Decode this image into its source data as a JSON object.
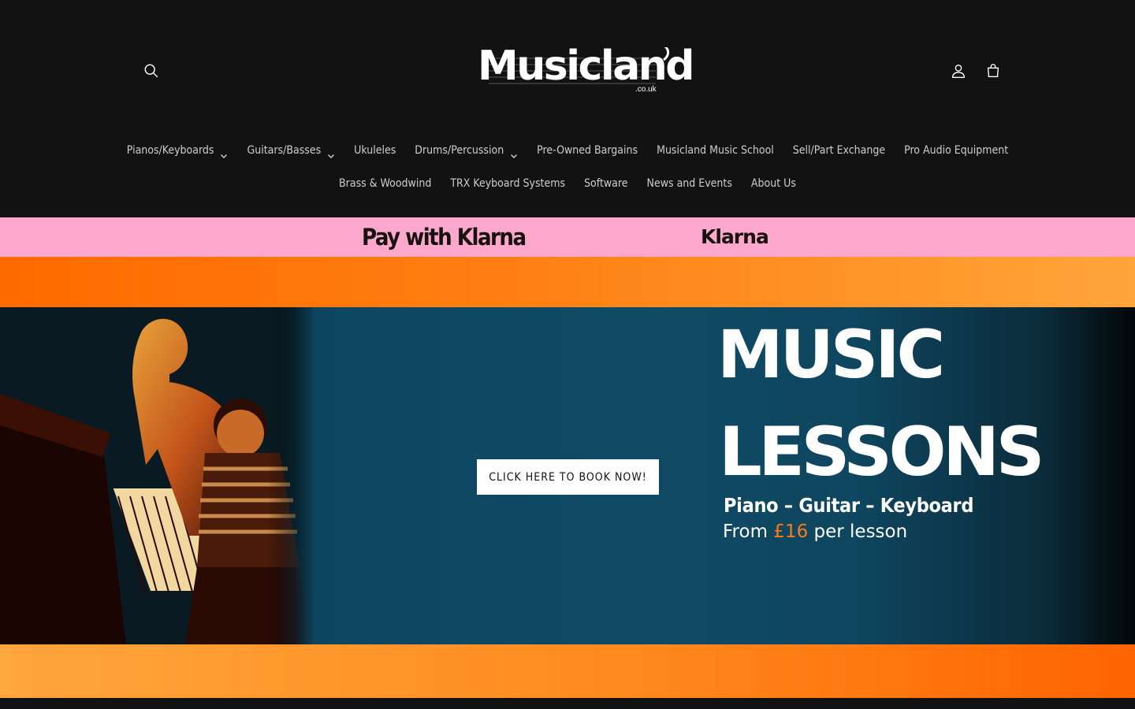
{
  "header": {
    "logo_text": "Musicland",
    "logo_sub": ".co.uk",
    "search_icon": "search-icon",
    "account_icon": "account-icon",
    "cart_icon": "cart-icon"
  },
  "nav": {
    "row1": [
      {
        "label": "Pianos/Keyboards",
        "dropdown": true
      },
      {
        "label": "Guitars/Basses",
        "dropdown": true
      },
      {
        "label": "Ukuleles",
        "dropdown": false
      },
      {
        "label": "Drums/Percussion",
        "dropdown": true
      },
      {
        "label": "Pre-Owned Bargains",
        "dropdown": false
      },
      {
        "label": "Musicland Music School",
        "dropdown": false
      },
      {
        "label": "Sell/Part Exchange",
        "dropdown": false
      },
      {
        "label": "Pro Audio Equipment",
        "dropdown": false
      }
    ],
    "row2": [
      {
        "label": "Brass & Woodwind",
        "dropdown": false
      },
      {
        "label": "TRX Keyboard Systems",
        "dropdown": false
      },
      {
        "label": "Software",
        "dropdown": false
      },
      {
        "label": "News and Events",
        "dropdown": false
      },
      {
        "label": "About Us",
        "dropdown": false
      }
    ]
  },
  "klarna": {
    "pay_text": "Pay with Klarna",
    "logo_text": "Klarna",
    "background": "#ffa8cd"
  },
  "banner": {
    "cta_label": "CLICK HERE TO BOOK NOW!",
    "title_line1": "MUSIC",
    "title_line2": "LESSONS",
    "instruments": "Piano – Guitar – Keyboard",
    "price_prefix": "From ",
    "price_value": "£16",
    "price_suffix": " per lesson",
    "accent_color": "#ff7a1a"
  }
}
